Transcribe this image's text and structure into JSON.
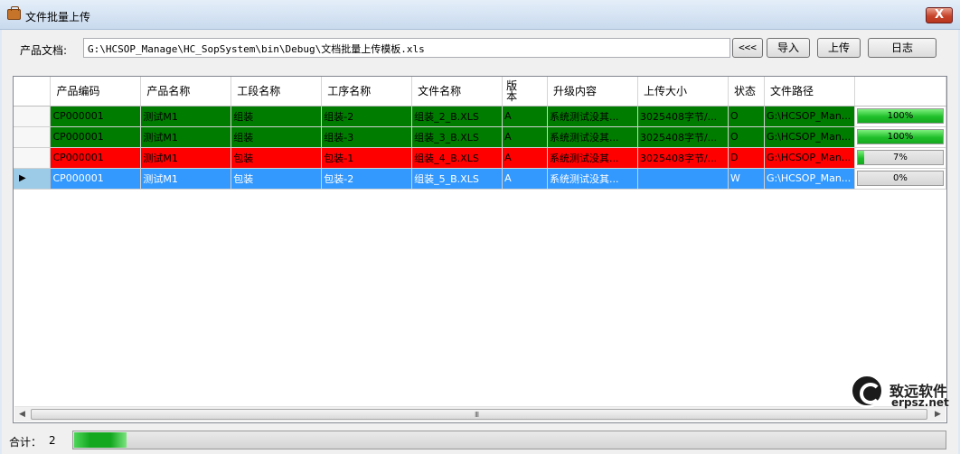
{
  "window": {
    "title": "文件批量上传",
    "close_label": "X"
  },
  "toolbar": {
    "doc_label": "产品文档:",
    "doc_path": "G:\\HCSOP_Manage\\HC_SopSystem\\bin\\Debug\\文档批量上传模板.xls",
    "browse_label": "<<<",
    "import_label": "导入",
    "upload_label": "上传",
    "log_label": "日志"
  },
  "grid": {
    "columns": [
      "产品编码",
      "产品名称",
      "工段名称",
      "工序名称",
      "文件名称",
      "版本",
      "升级内容",
      "上传大小",
      "状态",
      "文件路径",
      ""
    ],
    "rows": [
      {
        "bg": "#007d00",
        "selected": false,
        "progress": 100,
        "progress_label": "100%",
        "cells": [
          "CP000001",
          "测试M1",
          "组装",
          "组装-2",
          "组装_2_B.XLS",
          "A",
          "系统测试没其...",
          "3025408字节/...",
          "O",
          "G:\\HCSOP_Man..."
        ]
      },
      {
        "bg": "#007d00",
        "selected": false,
        "progress": 100,
        "progress_label": "100%",
        "cells": [
          "CP000001",
          "测试M1",
          "组装",
          "组装-3",
          "组装_3_B.XLS",
          "A",
          "系统测试没其...",
          "3025408字节/...",
          "O",
          "G:\\HCSOP_Man..."
        ]
      },
      {
        "bg": "#ff0000",
        "selected": false,
        "progress": 7,
        "progress_label": "7%",
        "cells": [
          "CP000001",
          "测试M1",
          "包装",
          "包装-1",
          "组装_4_B.XLS",
          "A",
          "系统测试没其...",
          "3025408字节/...",
          "D",
          "G:\\HCSOP_Man..."
        ]
      },
      {
        "bg": "#3399ff",
        "selected": true,
        "progress": 0,
        "progress_label": "0%",
        "cells": [
          "CP000001",
          "测试M1",
          "包装",
          "包装-2",
          "组装_5_B.XLS",
          "A",
          "系统测试没其...",
          "",
          "W",
          "G:\\HCSOP_Man..."
        ]
      }
    ],
    "scroll_grip": "III"
  },
  "watermark": {
    "brand_cn": "致远软件",
    "brand_url": "erpsz.net"
  },
  "status": {
    "total_label": "合计：",
    "total_value": "2",
    "progress": 6
  }
}
